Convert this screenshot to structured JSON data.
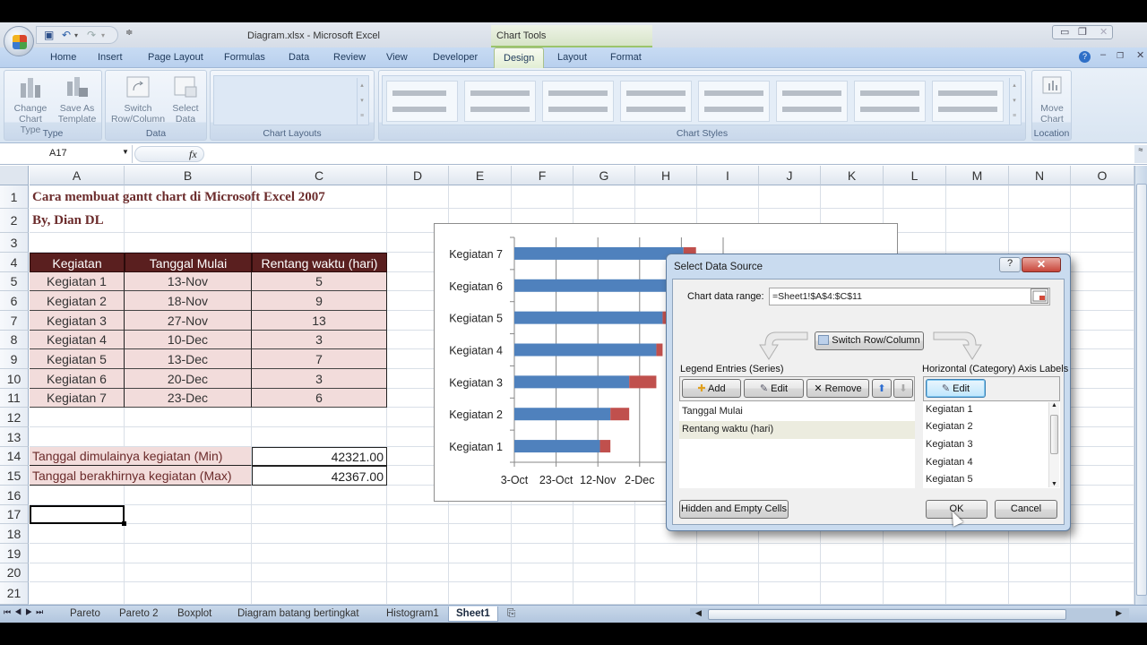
{
  "window": {
    "title": "Diagram.xlsx - Microsoft Excel",
    "contextual_tab_group": "Chart Tools",
    "qat_icons": [
      "save-icon",
      "undo-icon",
      "redo-icon",
      "customize-qat-icon"
    ]
  },
  "ribbon": {
    "tabs": [
      "Home",
      "Insert",
      "Page Layout",
      "Formulas",
      "Data",
      "Review",
      "View",
      "Developer",
      "Design",
      "Layout",
      "Format"
    ],
    "active_tab": "Design",
    "groups": {
      "type": {
        "label": "Type",
        "buttons": [
          "Change Chart Type",
          "Save As Template"
        ]
      },
      "data": {
        "label": "Data",
        "buttons": [
          "Switch Row/Column",
          "Select Data"
        ]
      },
      "chart_layouts": {
        "label": "Chart Layouts"
      },
      "chart_styles": {
        "label": "Chart Styles"
      },
      "location": {
        "label": "Location",
        "buttons": [
          "Move Chart"
        ]
      }
    }
  },
  "formula_bar": {
    "name_box": "A17",
    "fx_label": "fx",
    "formula": ""
  },
  "sheet": {
    "columns": [
      "A",
      "B",
      "C",
      "D",
      "E",
      "F",
      "G",
      "H",
      "I",
      "J",
      "K",
      "L",
      "M",
      "N",
      "O"
    ],
    "rows": [
      "1",
      "2",
      "3",
      "4",
      "5",
      "6",
      "7",
      "8",
      "9",
      "10",
      "11",
      "12",
      "13",
      "14",
      "15",
      "16",
      "17",
      "18",
      "19",
      "20",
      "21"
    ],
    "title": "Cara membuat gantt chart di Microsoft Excel 2007",
    "author": "By, Dian DL",
    "table_headers": [
      "Kegiatan",
      "Tanggal Mulai",
      "Rentang waktu (hari)"
    ],
    "table_rows": [
      [
        "Kegiatan 1",
        "13-Nov",
        "5"
      ],
      [
        "Kegiatan 2",
        "18-Nov",
        "9"
      ],
      [
        "Kegiatan 3",
        "27-Nov",
        "13"
      ],
      [
        "Kegiatan 4",
        "10-Dec",
        "3"
      ],
      [
        "Kegiatan 5",
        "13-Dec",
        "7"
      ],
      [
        "Kegiatan 6",
        "20-Dec",
        "3"
      ],
      [
        "Kegiatan 7",
        "23-Dec",
        "6"
      ]
    ],
    "summary": [
      {
        "label": "Tanggal dimulainya kegiatan (Min)",
        "value": "42321.00"
      },
      {
        "label": "Tanggal berakhirnya kegiatan (Max)",
        "value": "42367.00"
      }
    ],
    "selected_cell": "A17"
  },
  "chart_data": {
    "type": "bar",
    "orientation": "horizontal-stacked",
    "categories": [
      "Kegiatan 1",
      "Kegiatan 2",
      "Kegiatan 3",
      "Kegiatan 4",
      "Kegiatan 5",
      "Kegiatan 6",
      "Kegiatan 7"
    ],
    "series": [
      {
        "name": "Tanggal Mulai",
        "values_days_from_3oct": [
          41,
          46,
          55,
          68,
          71,
          78,
          81
        ],
        "color": "#4f81bd"
      },
      {
        "name": "Rentang waktu (hari)",
        "values": [
          5,
          9,
          13,
          3,
          7,
          3,
          6
        ],
        "color": "#c0504d"
      }
    ],
    "x_tick_labels": [
      "3-Oct",
      "23-Oct",
      "12-Nov",
      "2-Dec"
    ],
    "x_tick_step_days": 20,
    "xlim_days_from_3oct": [
      0,
      100
    ],
    "grid": true,
    "legend": "none"
  },
  "dialog": {
    "title": "Select Data Source",
    "help_icon": "?",
    "close_icon": "✕",
    "chart_data_range_label": "Chart data range:",
    "chart_data_range": "=Sheet1!$A$4:$C$11",
    "switch_button": "Switch Row/Column",
    "legend_entries_label": "Legend Entries (Series)",
    "series_buttons": {
      "add": "Add",
      "edit": "Edit",
      "remove": "Remove"
    },
    "series": [
      "Tanggal Mulai",
      "Rentang waktu (hari)"
    ],
    "selected_series": "Rentang waktu (hari)",
    "axis_labels_label": "Horizontal (Category) Axis Labels",
    "axis_edit_button": "Edit",
    "axis_labels": [
      "Kegiatan 1",
      "Kegiatan 2",
      "Kegiatan 3",
      "Kegiatan 4",
      "Kegiatan 5"
    ],
    "hidden_empty_button": "Hidden and Empty Cells",
    "ok": "OK",
    "cancel": "Cancel"
  },
  "sheet_tabs": {
    "tabs": [
      "Pareto",
      "Pareto 2",
      "Boxplot",
      "Diagram batang bertingkat",
      "Histogram1",
      "Sheet1"
    ],
    "active": "Sheet1"
  }
}
